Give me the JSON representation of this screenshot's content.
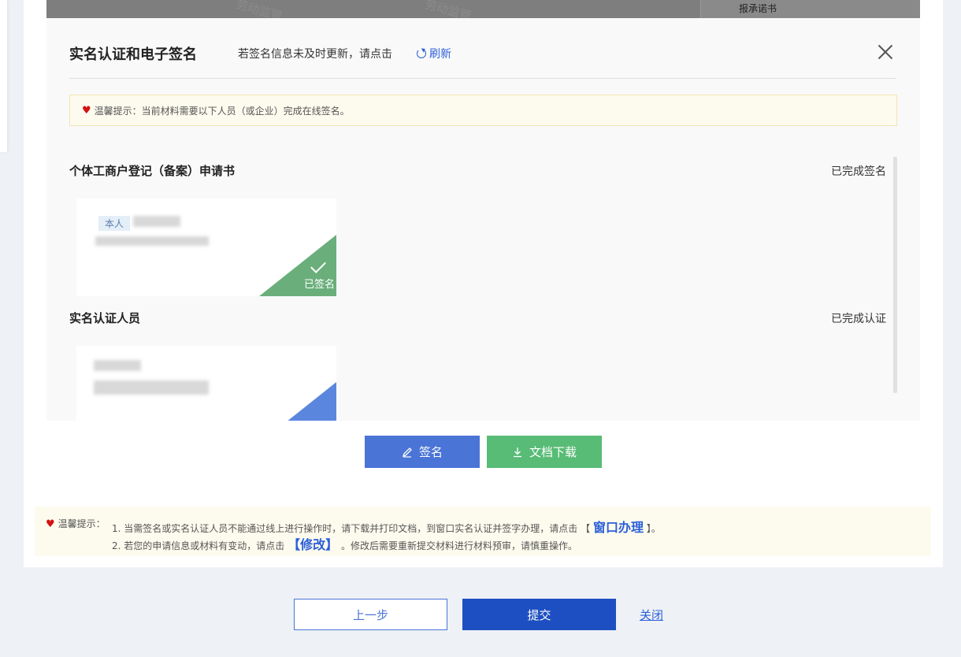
{
  "background_bar": {
    "watermark": "劳动监管",
    "right_cell_text": "报承诺书"
  },
  "modal": {
    "title": "实名认证和电子签名",
    "hint": "若签名信息未及时更新，请点击",
    "refresh_label": "刷新",
    "tip_prefix": "温馨提示：",
    "tip_text": "当前材料需要以下人员（或企业）完成在线签名。",
    "sections": [
      {
        "title": "个体工商户登记（备案）申请书",
        "status": "已完成签名",
        "card": {
          "tag": "本人",
          "corner_label": "已签名"
        }
      },
      {
        "title": "实名认证人员",
        "status": "已完成认证"
      }
    ]
  },
  "actions": {
    "sign_label": "签名",
    "download_label": "文档下载"
  },
  "notice": {
    "label": "温馨提示：",
    "line1_prefix": "1. 当需签名或实名认证人员不能通过线上进行操作时，请下载并打印文档，到窗口实名认证并签字办理，请点击",
    "line1_bracket_open": "【",
    "line1_link": "窗口办理",
    "line1_bracket_close": "】。",
    "line2_prefix": "2. 若您的申请信息或材料有变动，请点击",
    "line2_link": "【修改】",
    "line2_suffix": "。修改后需要重新提交材料进行材料预审，请慎重操作。"
  },
  "footer": {
    "prev_label": "上一步",
    "submit_label": "提交",
    "close_label": "关闭"
  },
  "colors": {
    "primary": "#1e4fc2",
    "sign_button": "#4a74d6",
    "download_button": "#58bb76",
    "signed_corner": "#6aaf7b",
    "tip_heart": "#d31212"
  }
}
